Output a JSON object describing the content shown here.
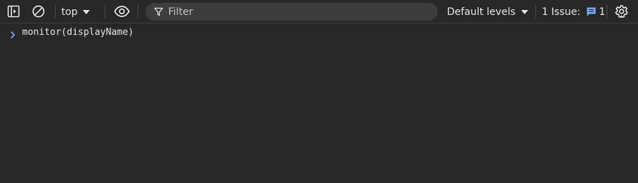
{
  "toolbar": {
    "context": "top",
    "filter_placeholder": "Filter",
    "levels_label": "Default levels",
    "issues_label": "1 Issue:",
    "issues_count": "1"
  },
  "icons": {
    "sidebar": "sidebar-toggle-icon",
    "clear": "clear-console-icon",
    "eye": "live-expression-eye-icon",
    "filter": "filter-funnel-icon",
    "issue": "issue-message-icon",
    "settings": "gear-icon",
    "prompt": "chevron-right-icon"
  },
  "colors": {
    "background": "#282828",
    "text": "#e3e3e3",
    "filter_bg": "#3d3d3d",
    "accent_blue": "#7cacf8"
  },
  "console": {
    "lines": [
      {
        "text": "monitor(displayName)"
      }
    ]
  }
}
